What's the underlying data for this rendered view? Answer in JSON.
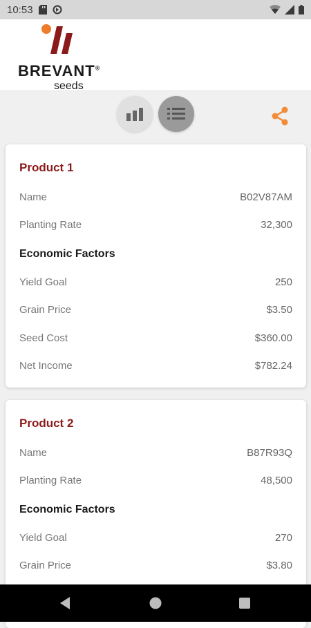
{
  "status_bar": {
    "time": "10:53",
    "icons": [
      "sd-card-icon",
      "data-saver-icon",
      "wifi-icon",
      "signal-icon",
      "battery-icon"
    ]
  },
  "header": {
    "brand_name": "BREVANT",
    "brand_tm": "®",
    "brand_sub": "seeds",
    "colors": {
      "logo_dot": "#ee7d2b",
      "logo_bars": "#8b1a1a"
    }
  },
  "toolbar": {
    "chart_icon": "bar-chart-icon",
    "list_icon": "list-icon",
    "share_icon": "share-icon",
    "accent": "#f28c38"
  },
  "products": [
    {
      "title": "Product 1",
      "name_label": "Name",
      "name_value": "B02V87AM",
      "rate_label": "Planting Rate",
      "rate_value": "32,300",
      "econ_title": "Economic Factors",
      "yield_label": "Yield Goal",
      "yield_value": "250",
      "grain_label": "Grain Price",
      "grain_value": "$3.50",
      "seed_label": "Seed Cost",
      "seed_value": "$360.00",
      "net_label": "Net Income",
      "net_value": "$782.24"
    },
    {
      "title": "Product 2",
      "name_label": "Name",
      "name_value": "B87R93Q",
      "rate_label": "Planting Rate",
      "rate_value": "48,500",
      "econ_title": "Economic Factors",
      "yield_label": "Yield Goal",
      "yield_value": "270",
      "grain_label": "Grain Price",
      "grain_value": "$3.80"
    }
  ],
  "nav_bar": {
    "icons": [
      "back-icon",
      "home-icon",
      "recents-icon"
    ]
  }
}
